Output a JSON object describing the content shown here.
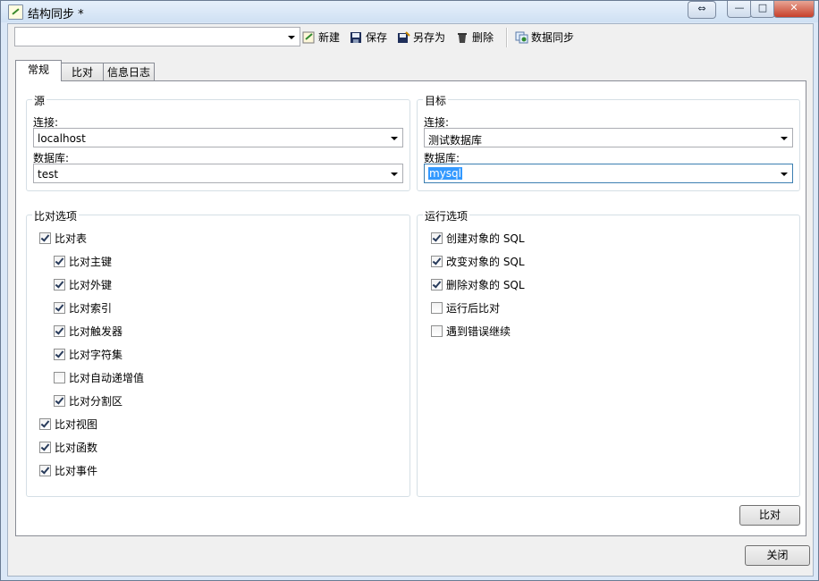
{
  "window": {
    "title": "结构同步 *"
  },
  "titlebar_buttons": {
    "restore_glyph": "⇔",
    "minimize_glyph": "—",
    "maximize_glyph": "□",
    "close_glyph": "✕"
  },
  "toolbar": {
    "profile_value": "",
    "new_label": "新建",
    "save_label": "保存",
    "save_as_label": "另存为",
    "delete_label": "删除",
    "sync_label": "数据同步"
  },
  "tabs": [
    {
      "label": "常规"
    },
    {
      "label": "比对"
    },
    {
      "label": "信息日志"
    }
  ],
  "source": {
    "title": "源",
    "connection_label": "连接:",
    "connection_value": "localhost",
    "database_label": "数据库:",
    "database_value": "test"
  },
  "target": {
    "title": "目标",
    "connection_label": "连接:",
    "connection_value": "测试数据库",
    "database_label": "数据库:",
    "database_value": "mysql"
  },
  "compare_options": {
    "title": "比对选项",
    "items": [
      {
        "label": "比对表",
        "checked": true
      },
      {
        "label": "比对主键",
        "checked": true
      },
      {
        "label": "比对外键",
        "checked": true
      },
      {
        "label": "比对索引",
        "checked": true
      },
      {
        "label": "比对触发器",
        "checked": true
      },
      {
        "label": "比对字符集",
        "checked": true
      },
      {
        "label": "比对自动递增值",
        "checked": false
      },
      {
        "label": "比对分割区",
        "checked": true
      },
      {
        "label": "比对视图",
        "checked": true
      },
      {
        "label": "比对函数",
        "checked": true
      },
      {
        "label": "比对事件",
        "checked": true
      }
    ]
  },
  "run_options": {
    "title": "运行选项",
    "items": [
      {
        "label": "创建对象的 SQL",
        "checked": true
      },
      {
        "label": "改变对象的 SQL",
        "checked": true
      },
      {
        "label": "删除对象的 SQL",
        "checked": true
      },
      {
        "label": "运行后比对",
        "checked": false
      },
      {
        "label": "遇到错误继续",
        "checked": false
      }
    ]
  },
  "buttons": {
    "compare_label": "比对",
    "close_label": "关闭"
  }
}
